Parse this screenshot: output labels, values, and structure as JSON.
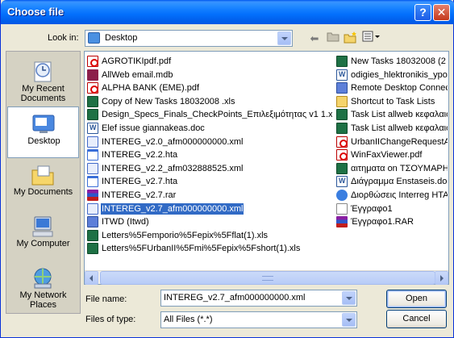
{
  "window": {
    "title": "Choose file",
    "help_label": "?",
    "close_label": "✕"
  },
  "toolbar": {
    "lookin_label": "Look in:",
    "lookin_value": "Desktop",
    "back_icon": "back-arrow-icon",
    "up_icon": "up-folder-icon",
    "newfolder_icon": "new-folder-icon",
    "views_icon": "views-menu-icon"
  },
  "places": [
    {
      "label": "My Recent Documents",
      "icon": "recent-documents-icon"
    },
    {
      "label": "Desktop",
      "icon": "desktop-icon",
      "selected": true
    },
    {
      "label": "My Documents",
      "icon": "my-documents-icon"
    },
    {
      "label": "My Computer",
      "icon": "my-computer-icon"
    },
    {
      "label": "My Network Places",
      "icon": "network-places-icon"
    }
  ],
  "files_col1": [
    {
      "name": "AGROTIKIpdf.pdf",
      "type": "pdf"
    },
    {
      "name": "AllWeb email.mdb",
      "type": "mdb"
    },
    {
      "name": "ALPHA BANK (EME).pdf",
      "type": "pdf"
    },
    {
      "name": "Copy of New Tasks 18032008  .xls",
      "type": "xls"
    },
    {
      "name": "Design_Specs_Finals_CheckPoints_Επιλεξιμότητας v1 1.xls",
      "type": "xls"
    },
    {
      "name": "Elef issue giannakeas.doc",
      "type": "doc"
    },
    {
      "name": "INTEREG_v2.0_afm000000000.xml",
      "type": "xml"
    },
    {
      "name": "INTEREG_v2.2.hta",
      "type": "hta"
    },
    {
      "name": "INTEREG_v2.2_afm032888525.xml",
      "type": "xml"
    },
    {
      "name": "INTEREG_v2.7.hta",
      "type": "hta"
    },
    {
      "name": "INTEREG_v2.7.rar",
      "type": "rar"
    },
    {
      "name": "INTEREG_v2.7_afm000000000.xml",
      "type": "xml",
      "selected": true
    },
    {
      "name": "ITWD (Itwd)",
      "type": "rdp"
    },
    {
      "name": "Letters%5Femporio%5Fepix%5Fflat(1).xls",
      "type": "xls"
    },
    {
      "name": "Letters%5FUrbanII%5Fmi%5Fepix%5Fshort(1).xls",
      "type": "xls"
    }
  ],
  "files_col2": [
    {
      "name": "New Tasks 18032008  (2",
      "type": "xls"
    },
    {
      "name": "odigies_hlektronikis_ypov",
      "type": "doc"
    },
    {
      "name": "Remote Desktop Connec",
      "type": "rdp"
    },
    {
      "name": "Shortcut to Task Lists",
      "type": "lnk"
    },
    {
      "name": "Task List allweb κεφαλαιο",
      "type": "xls"
    },
    {
      "name": "Task List allweb κεφαλαιο",
      "type": "xls"
    },
    {
      "name": "UrbanIIChangeRequestA",
      "type": "pdf"
    },
    {
      "name": "WinFaxViewer.pdf",
      "type": "pdf"
    },
    {
      "name": "αιτηματα on ΤΣΟΥΜΑΡΗ .",
      "type": "xls"
    },
    {
      "name": "Διάγραμμα Enstaseis.doc",
      "type": "doc"
    },
    {
      "name": "Διορθώσεις Interreg  HTA",
      "type": "ie"
    },
    {
      "name": "Έγγραφο1",
      "type": "txt"
    },
    {
      "name": "Έγγραφο1.RAR",
      "type": "rar"
    }
  ],
  "bottom": {
    "filename_label": "File name:",
    "filename_value": "INTEREG_v2.7_afm000000000.xml",
    "filetype_label": "Files of type:",
    "filetype_value": "All Files (*.*)",
    "open_label": "Open",
    "cancel_label": "Cancel"
  }
}
